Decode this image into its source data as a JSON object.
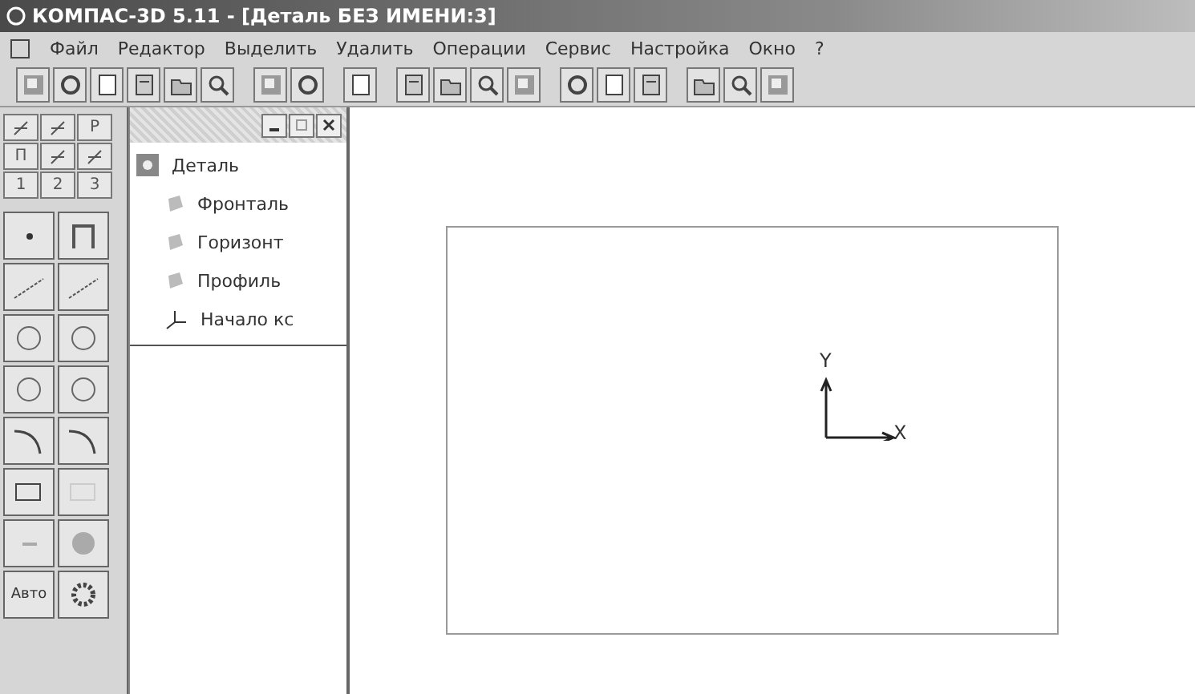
{
  "window": {
    "title": "КОМПАС-3D 5.11 - [Деталь БЕЗ ИМЕНИ:3]"
  },
  "menu": [
    {
      "label": "Файл"
    },
    {
      "label": "Редактор"
    },
    {
      "label": "Выделить"
    },
    {
      "label": "Удалить"
    },
    {
      "label": "Операции"
    },
    {
      "label": "Сервис"
    },
    {
      "label": "Настройка"
    },
    {
      "label": "Окно"
    },
    {
      "label": "?"
    }
  ],
  "palette": {
    "tabs": [
      {
        "kind": "icon"
      },
      {
        "kind": "icon"
      },
      {
        "kind": "text",
        "label": "P"
      },
      {
        "kind": "text",
        "label": "П"
      },
      {
        "kind": "icon"
      },
      {
        "kind": "icon"
      },
      {
        "kind": "text",
        "label": "1"
      },
      {
        "kind": "text",
        "label": "2"
      },
      {
        "kind": "text",
        "label": "3"
      }
    ],
    "auto_button": {
      "label": "Авто"
    }
  },
  "tree": {
    "items": [
      {
        "kind": "part",
        "label": "Деталь"
      },
      {
        "kind": "plane",
        "label": "Фронталь"
      },
      {
        "kind": "plane",
        "label": "Горизонт"
      },
      {
        "kind": "plane",
        "label": "Профиль"
      },
      {
        "kind": "origin",
        "label": "Начало кс"
      }
    ]
  },
  "canvas": {
    "axis_y": "Y",
    "axis_x": "X"
  }
}
